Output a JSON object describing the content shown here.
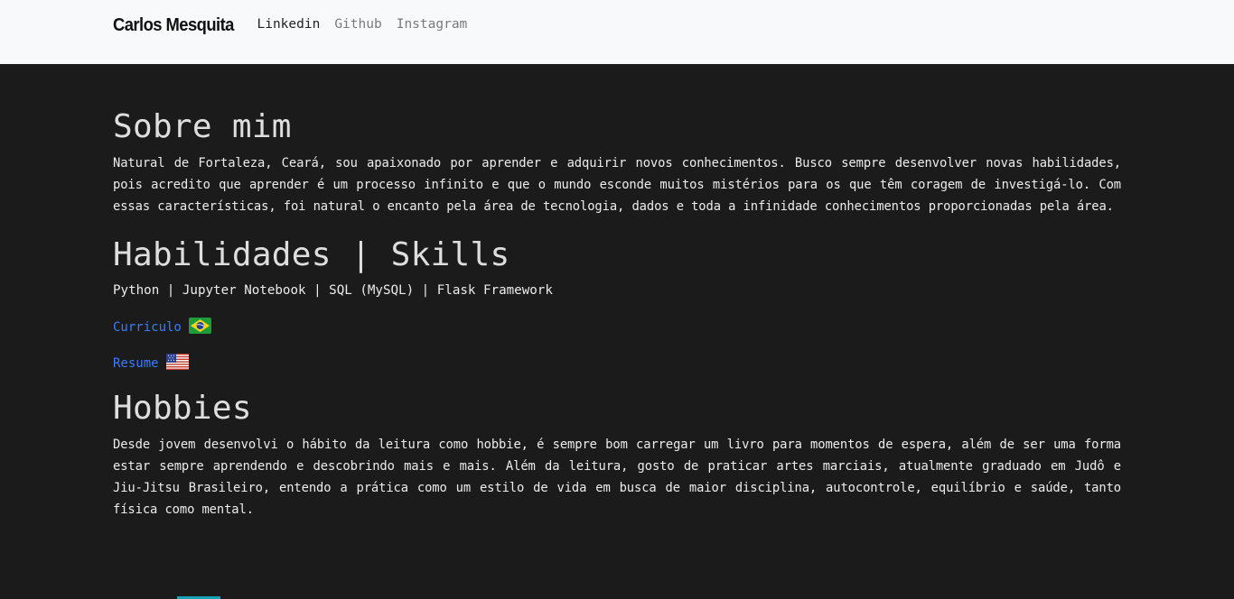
{
  "navbar": {
    "brand": "Carlos Mesquita",
    "links": [
      "Linkedin",
      "Github",
      "Instagram"
    ]
  },
  "about": {
    "title": "Sobre mim",
    "text": "Natural de Fortaleza, Ceará, sou apaixonado por aprender e adquirir novos conhecimentos. Busco sempre desenvolver novas habilidades, pois acredito que aprender é um processo infinito e que o mundo esconde muitos mistérios para os que têm coragem de investigá-lo. Com essas características, foi natural o encanto pela área de tecnologia, dados e toda a infinidade conhecimentos proporcionadas pela área."
  },
  "skills": {
    "title": "Habilidades | Skills",
    "list": "Python | Jupyter Notebook | SQL (MySQL) | Flask Framework",
    "curriculo_label": "Curriculo",
    "curriculo_icon": "brazil-flag-icon",
    "resume_label": "Resume",
    "resume_icon": "usa-flag-icon"
  },
  "hobbies": {
    "title": "Hobbies",
    "text": "Desde jovem desenvolvi o hábito da leitura como hobbie, é sempre bom carregar um livro para momentos de espera, além de ser uma forma estar sempre aprendendo e descobrindo mais e mais. Além da leitura, gosto de praticar artes marciais, atualmente graduado em Judô e Jiu-Jitsu Brasileiro, entendo a prática como um estilo de vida em busca de maior disciplina, autocontrole, equilíbrio e saúde, tanto física como mental."
  },
  "colors": {
    "background": "#1b1b1b",
    "navbar": "#f8f9fa",
    "link": "#3d7bff"
  }
}
